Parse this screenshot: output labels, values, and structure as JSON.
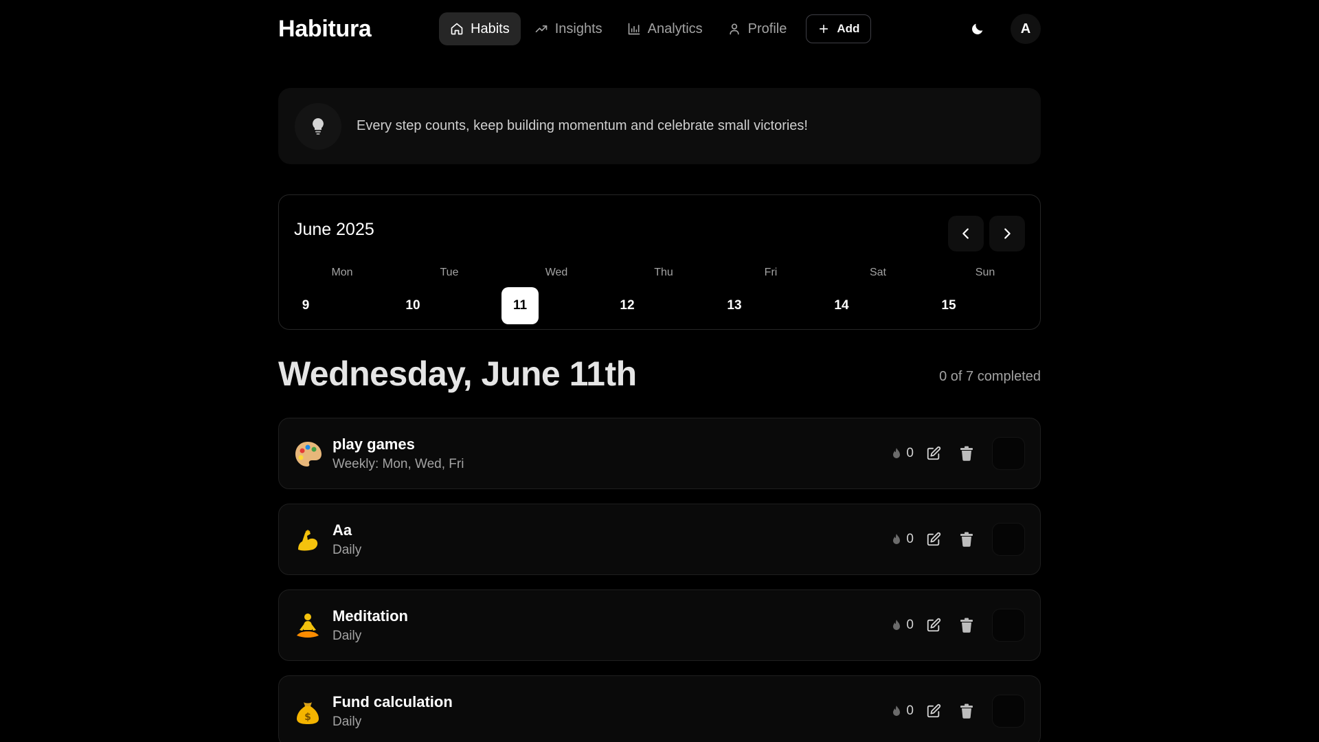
{
  "header": {
    "brand": "Habitura",
    "nav": [
      {
        "label": "Habits",
        "icon": "home-icon",
        "active": true
      },
      {
        "label": "Insights",
        "icon": "trending-up-icon",
        "active": false
      },
      {
        "label": "Analytics",
        "icon": "bar-chart-icon",
        "active": false
      },
      {
        "label": "Profile",
        "icon": "user-icon",
        "active": false
      }
    ],
    "add_label": "Add",
    "theme_icon": "moon-icon",
    "avatar_initial": "A"
  },
  "tip": {
    "icon": "lightbulb-icon",
    "text": "Every step counts, keep building momentum and celebrate small victories!"
  },
  "calendar": {
    "month": "June 2025",
    "days": [
      {
        "name": "Mon",
        "num": "9",
        "selected": false
      },
      {
        "name": "Tue",
        "num": "10",
        "selected": false
      },
      {
        "name": "Wed",
        "num": "11",
        "selected": true
      },
      {
        "name": "Thu",
        "num": "12",
        "selected": false
      },
      {
        "name": "Fri",
        "num": "13",
        "selected": false
      },
      {
        "name": "Sat",
        "num": "14",
        "selected": false
      },
      {
        "name": "Sun",
        "num": "15",
        "selected": false
      }
    ]
  },
  "day": {
    "title": "Wednesday, June 11th",
    "completed": "0 of 7 completed"
  },
  "habits": [
    {
      "emoji": "palette-icon",
      "name": "play games",
      "frequency": "Weekly: Mon, Wed, Fri",
      "streak": "0"
    },
    {
      "emoji": "flexed-biceps-icon",
      "name": "Aa",
      "frequency": "Daily",
      "streak": "0"
    },
    {
      "emoji": "meditation-icon",
      "name": "Meditation",
      "frequency": "Daily",
      "streak": "0"
    },
    {
      "emoji": "money-bag-icon",
      "name": "Fund calculation",
      "frequency": "Daily",
      "streak": "0"
    }
  ],
  "colors": {
    "background": "#000000",
    "card": "#0a0a0a",
    "selected_day": "#ffffff",
    "muted_text": "#a3a3a3"
  }
}
